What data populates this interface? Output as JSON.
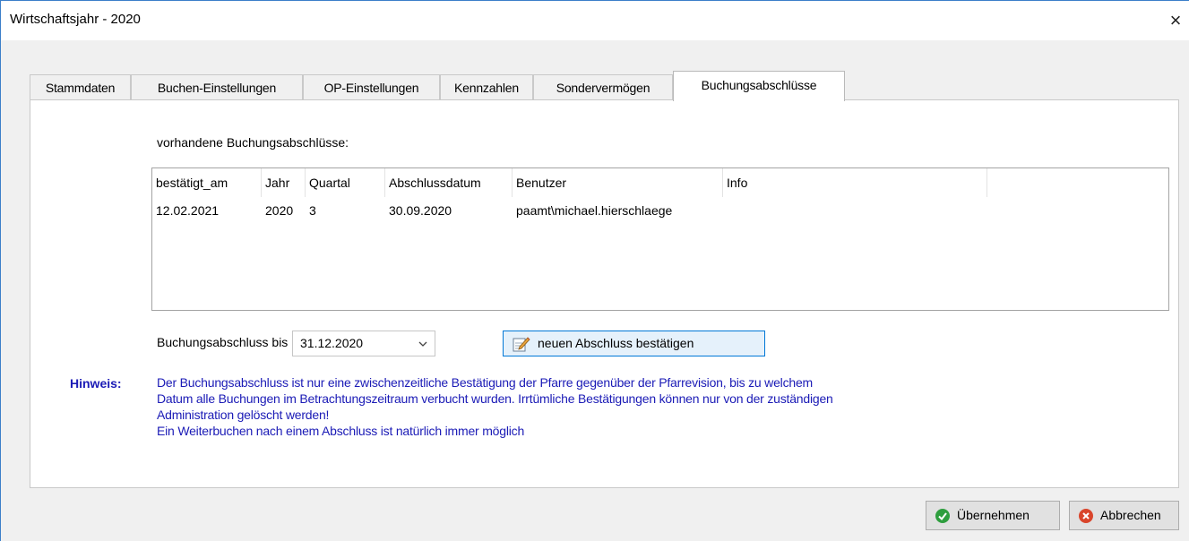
{
  "window": {
    "title": "Wirtschaftsjahr - 2020",
    "close_glyph": "×"
  },
  "tabs": [
    {
      "label": "Stammdaten",
      "active": false
    },
    {
      "label": "Buchen-Einstellungen",
      "active": false
    },
    {
      "label": "OP-Einstellungen",
      "active": false
    },
    {
      "label": "Kennzahlen",
      "active": false
    },
    {
      "label": "Sondervermögen",
      "active": false
    },
    {
      "label": "Buchungsabschlüsse",
      "active": true
    }
  ],
  "panel": {
    "section_label": "vorhandene Buchungsabschlüsse:",
    "table": {
      "columns": [
        "bestätigt_am",
        "Jahr",
        "Quartal",
        "Abschlussdatum",
        "Benutzer",
        "Info"
      ],
      "rows": [
        [
          "12.02.2021",
          "2020",
          "3",
          "30.09.2020",
          "paamt\\michael.hierschlaege",
          ""
        ]
      ]
    },
    "bis_label": "Buchungsabschluss bis",
    "bis_value": "31.12.2020",
    "confirm_button": "neuen Abschluss bestätigen",
    "hint_label": "Hinweis:",
    "hint_lines": [
      "Der Buchungsabschluss ist nur eine zwischenzeitliche Bestätigung der Pfarre gegenüber der Pfarrevision, bis zu welchem",
      "Datum alle Buchungen im Betrachtungszeitraum verbucht wurden. Irrtümliche Bestätigungen können nur von der zuständigen",
      "Administration gelöscht werden!",
      "Ein Weiterbuchen nach einem Abschluss ist natürlich immer möglich"
    ]
  },
  "footer": {
    "ok_label": "Übernehmen",
    "cancel_label": "Abbrechen"
  },
  "icons": {
    "ok": "check-circle-icon",
    "cancel": "x-circle-icon",
    "confirm": "edit-note-icon",
    "dropdown": "chevron-down-icon"
  },
  "colors": {
    "hint_text": "#1b1bb6",
    "ok_icon": "#2e9e3e",
    "cancel_icon": "#d9452b",
    "button_focus": "#0078d7"
  }
}
